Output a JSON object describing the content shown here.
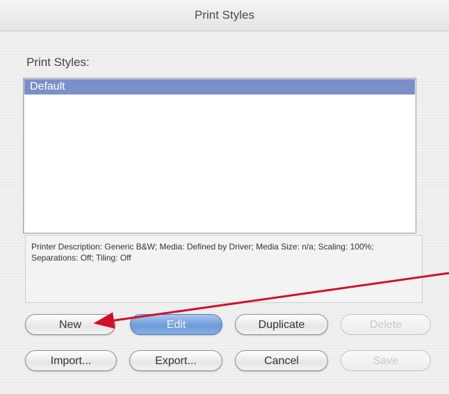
{
  "window": {
    "title": "Print Styles"
  },
  "list": {
    "label": "Print Styles:",
    "items": [
      {
        "label": "Default",
        "selected": true
      }
    ]
  },
  "description": {
    "text": "Printer Description: Generic B&W;  Media: Defined by Driver;  Media Size: n/a;  Scaling: 100%;  Separations: Off;  Tiling: Off"
  },
  "buttons": {
    "new": {
      "label": "New",
      "enabled": true
    },
    "edit": {
      "label": "Edit",
      "enabled": true,
      "default": true
    },
    "duplicate": {
      "label": "Duplicate",
      "enabled": true
    },
    "delete": {
      "label": "Delete",
      "enabled": false
    },
    "import": {
      "label": "Import...",
      "enabled": true
    },
    "export": {
      "label": "Export...",
      "enabled": true
    },
    "cancel": {
      "label": "Cancel",
      "enabled": true
    },
    "save": {
      "label": "Save",
      "enabled": false
    }
  },
  "colors": {
    "selection": "#7b8fc9",
    "default_button": "#6c9ad8",
    "annotation_arrow": "#d0102b"
  }
}
